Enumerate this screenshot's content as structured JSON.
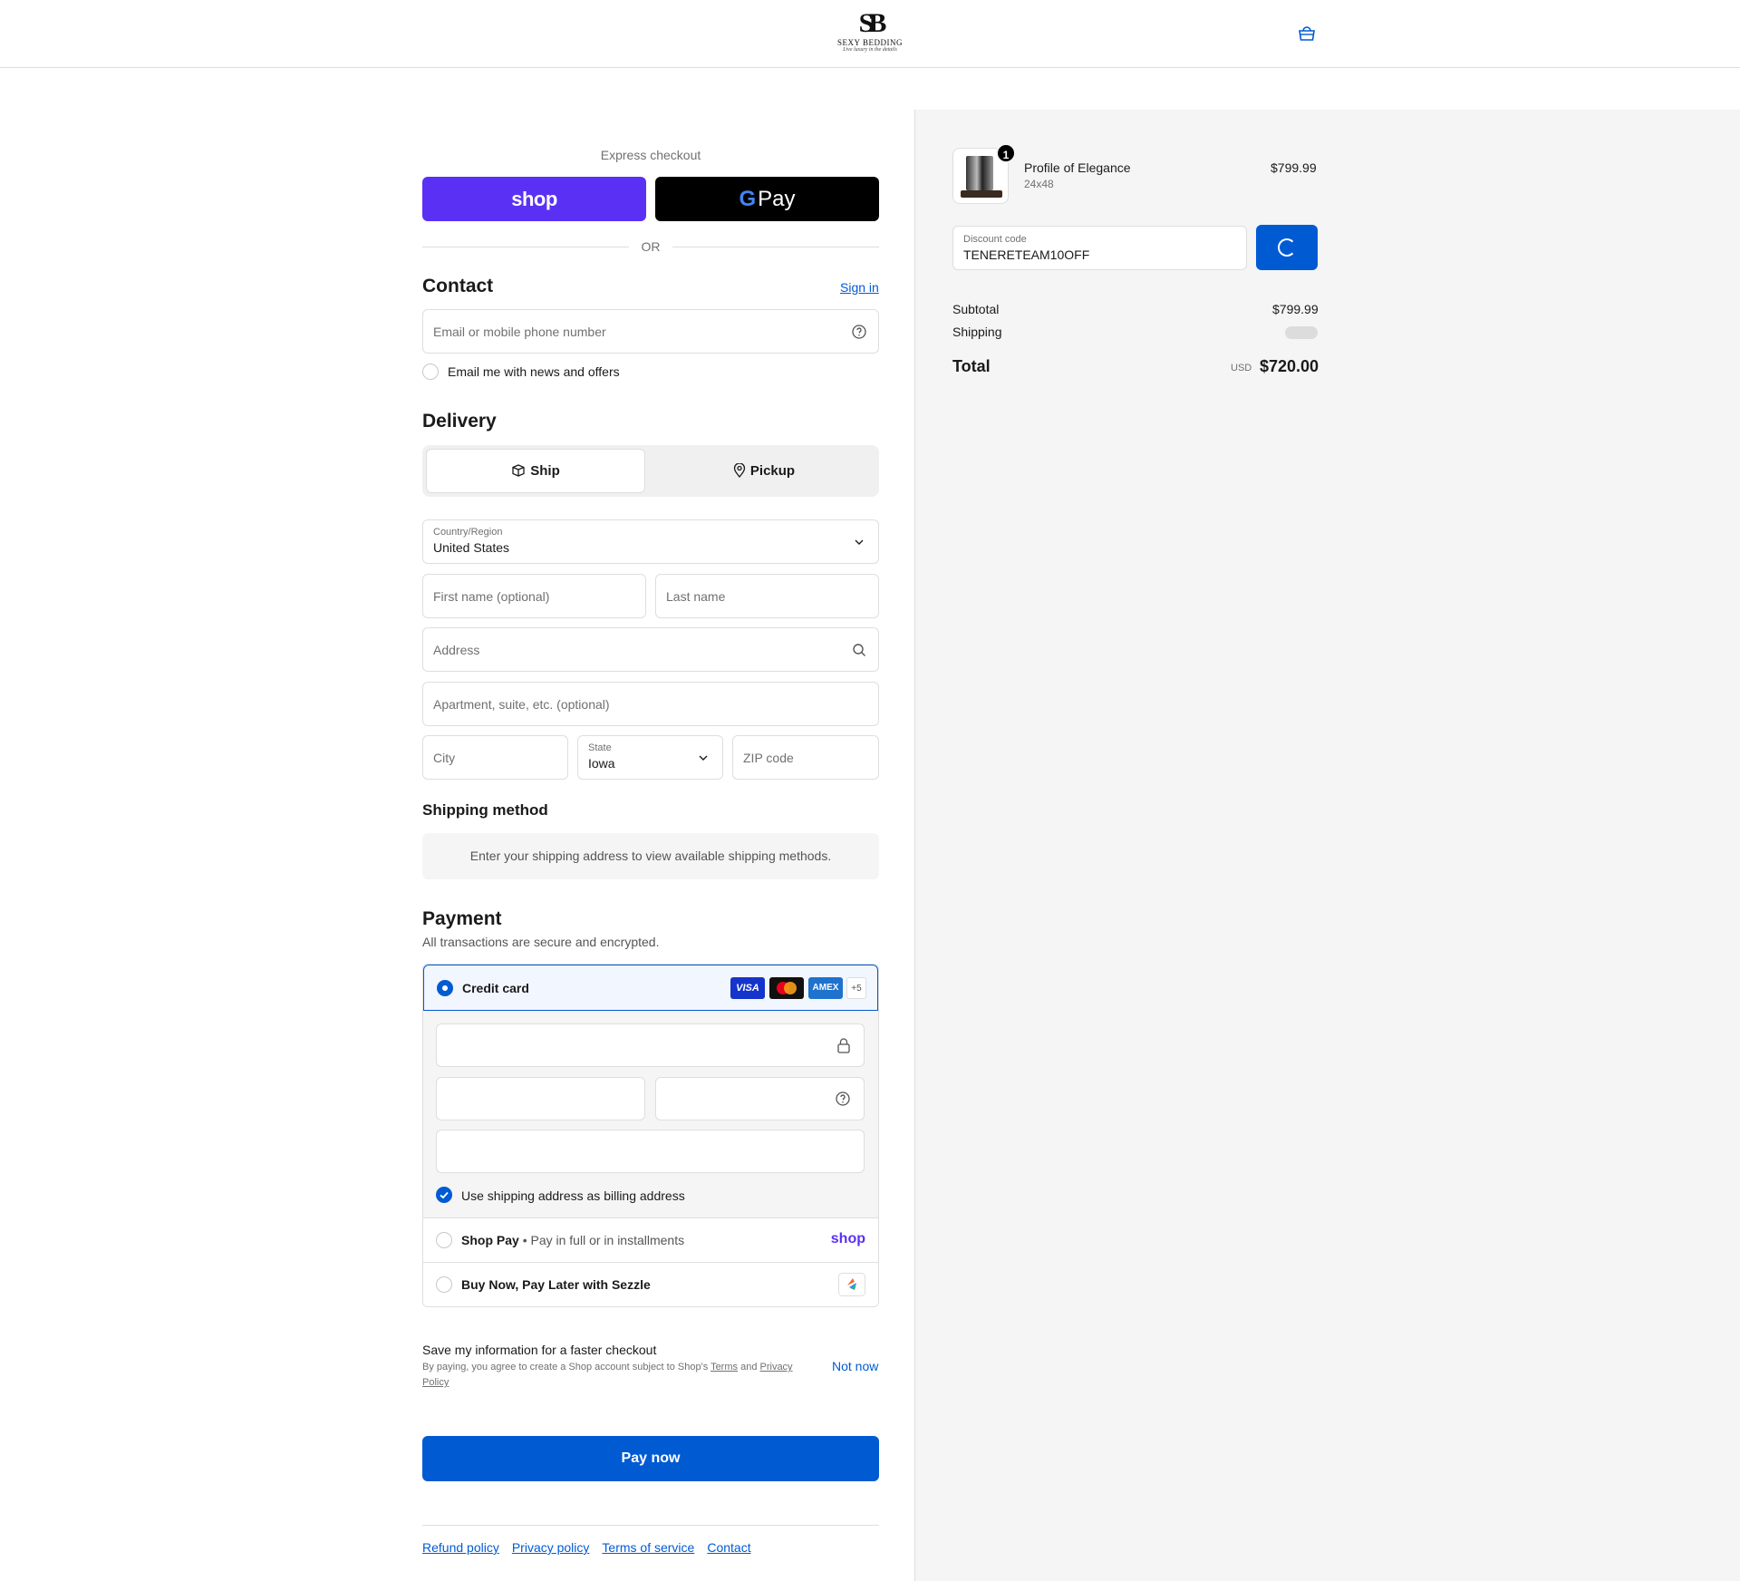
{
  "header": {
    "logo_monogram": "SB",
    "logo_brand": "SEXY BEDDING",
    "logo_tagline": "Live luxury in the details",
    "cart_icon": "cart-icon"
  },
  "express": {
    "title": "Express checkout",
    "shop_label": "shop",
    "gpay_g": "G",
    "gpay_label": "Pay",
    "or": "OR"
  },
  "contact": {
    "title": "Contact",
    "sign_in": "Sign in",
    "email_placeholder": "Email or mobile phone number",
    "news_label": "Email me with news and offers"
  },
  "delivery": {
    "title": "Delivery",
    "ship_label": "Ship",
    "pickup_label": "Pickup",
    "country_label": "Country/Region",
    "country_value": "United States",
    "first_name_placeholder": "First name (optional)",
    "last_name_placeholder": "Last name",
    "address_placeholder": "Address",
    "apartment_placeholder": "Apartment, suite, etc. (optional)",
    "city_placeholder": "City",
    "state_label": "State",
    "state_value": "Iowa",
    "zip_placeholder": "ZIP code"
  },
  "shipping_method": {
    "title": "Shipping method",
    "message": "Enter your shipping address to view available shipping methods."
  },
  "payment": {
    "title": "Payment",
    "subtitle": "All transactions are secure and encrypted.",
    "credit_card_label": "Credit card",
    "cards": [
      "VISA",
      "MC",
      "AMEX"
    ],
    "more_cards": "+5",
    "billing_label": "Use shipping address as billing address",
    "shop_pay_label": "Shop Pay",
    "shop_pay_sub": "• Pay in full or in installments",
    "shop_pay_logo": "shop",
    "sezzle_label": "Buy Now, Pay Later with Sezzle"
  },
  "save_info": {
    "title": "Save my information for a faster checkout",
    "legal_prefix": "By paying, you agree to create a Shop account subject to Shop's",
    "terms": "Terms",
    "and": "and",
    "privacy": "Privacy Policy",
    "not_now": "Not now"
  },
  "pay_now": "Pay now",
  "footer": {
    "links": [
      "Refund policy",
      "Privacy policy",
      "Terms of service",
      "Contact"
    ]
  },
  "summary": {
    "item_quantity": "1",
    "item_name": "Profile of Elegance",
    "item_variant": "24x48",
    "item_price": "$799.99",
    "discount_label": "Discount code",
    "discount_value": "TENERETEAM10OFF",
    "subtotal_label": "Subtotal",
    "subtotal_value": "$799.99",
    "shipping_label": "Shipping",
    "total_label": "Total",
    "currency": "USD",
    "total_value": "$720.00"
  },
  "colors": {
    "accent": "#005bd3",
    "shop_purple": "#5a31f4",
    "summary_bg": "#f5f5f5"
  }
}
